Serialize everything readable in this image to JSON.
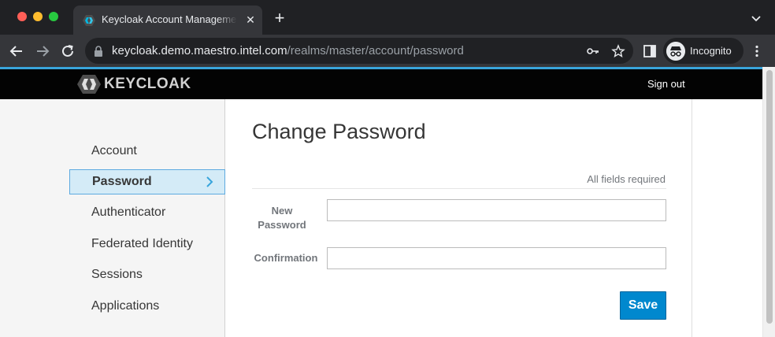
{
  "browser": {
    "tab_title": "Keycloak Account Management",
    "tab_close": "✕",
    "new_tab": "+",
    "url_host": "keycloak.demo.maestro.intel.com",
    "url_path": "/realms/master/account/password",
    "profile_label": "Incognito"
  },
  "header": {
    "logo_text": "KEYCLOAK",
    "signout_label": "Sign out"
  },
  "sidebar": {
    "items": [
      {
        "label": "Account",
        "active": false
      },
      {
        "label": "Password",
        "active": true
      },
      {
        "label": "Authenticator",
        "active": false
      },
      {
        "label": "Federated Identity",
        "active": false
      },
      {
        "label": "Sessions",
        "active": false
      },
      {
        "label": "Applications",
        "active": false
      }
    ]
  },
  "main": {
    "title": "Change Password",
    "required_note": "All fields required",
    "fields": {
      "new_password": {
        "label": "New Password",
        "value": ""
      },
      "confirmation": {
        "label": "Confirmation",
        "value": ""
      }
    },
    "save_label": "Save"
  },
  "colors": {
    "accent": "#39a5dc",
    "header_bg": "#030303",
    "primary_button": "#0088ce",
    "active_nav_bg": "#d4ebf7"
  }
}
